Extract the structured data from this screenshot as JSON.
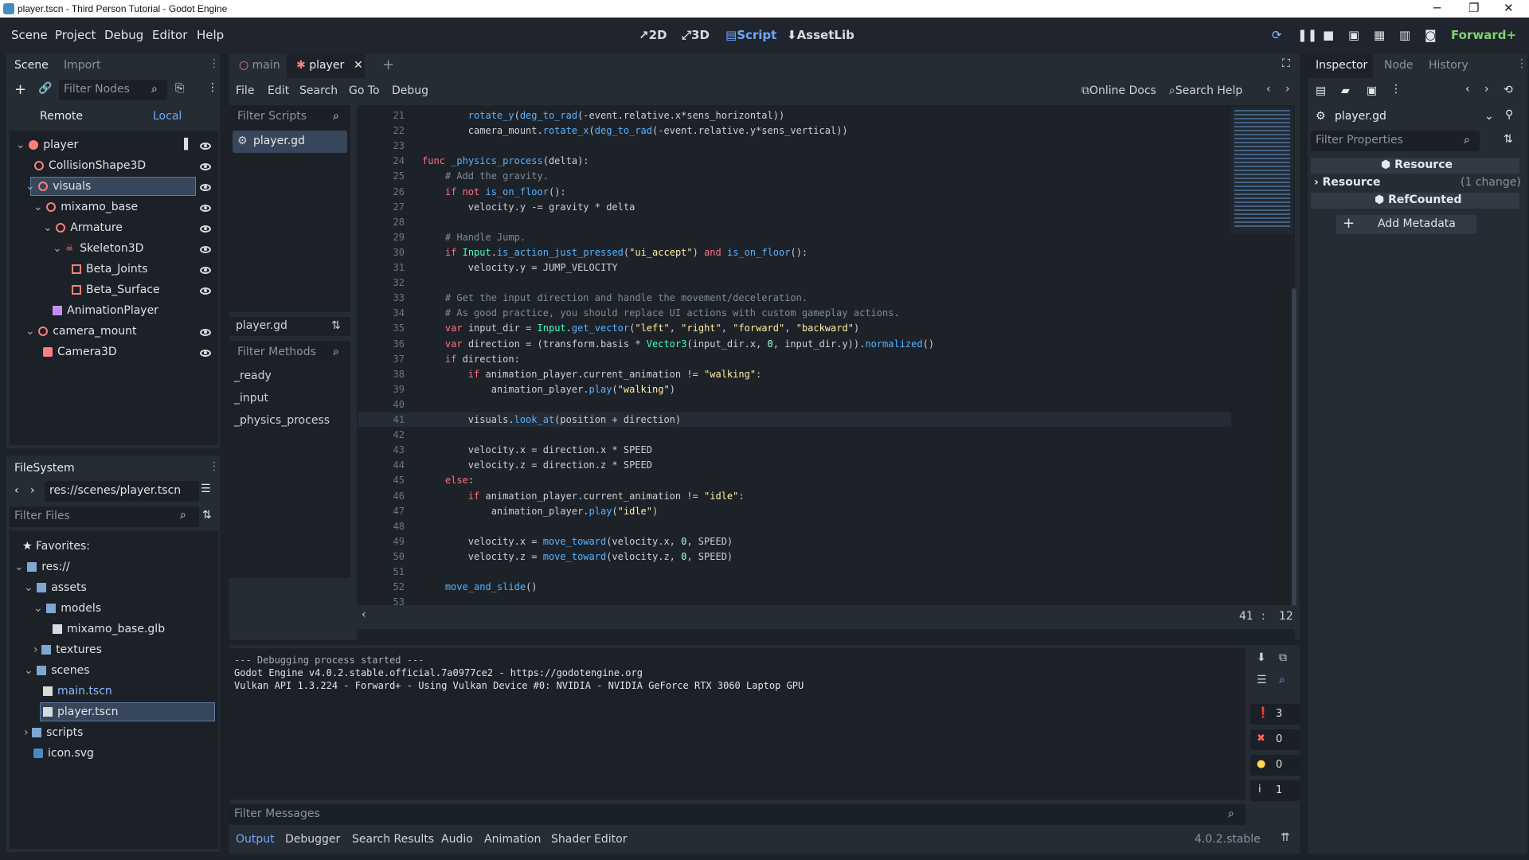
{
  "window_title": "player.tscn - Third Person Tutorial - Godot Engine",
  "menu": [
    "Scene",
    "Project",
    "Debug",
    "Editor",
    "Help"
  ],
  "workspaces": [
    "2D",
    "3D",
    "Script",
    "AssetLib"
  ],
  "renderer": "Forward+",
  "scene_panel": {
    "tabs": [
      "Scene",
      "Import"
    ],
    "filter_placeholder": "Filter Nodes",
    "remote": "Remote",
    "local": "Local",
    "nodes": [
      "player",
      "CollisionShape3D",
      "visuals",
      "mixamo_base",
      "Armature",
      "Skeleton3D",
      "Beta_Joints",
      "Beta_Surface",
      "AnimationPlayer",
      "camera_mount",
      "Camera3D"
    ]
  },
  "filesystem": {
    "tab": "FileSystem",
    "path": "res://scenes/player.tscn",
    "filter_placeholder": "Filter Files",
    "items": [
      "Favorites:",
      "res://",
      "assets",
      "models",
      "mixamo_base.glb",
      "textures",
      "scenes",
      "main.tscn",
      "player.tscn",
      "scripts",
      "icon.svg"
    ]
  },
  "editor_tabs": [
    "main",
    "player"
  ],
  "script_menu": [
    "File",
    "Edit",
    "Search",
    "Go To",
    "Debug"
  ],
  "online_docs": "Online Docs",
  "search_help": "Search Help",
  "scripts_panel": {
    "filter_placeholder": "Filter Scripts",
    "scripts": [
      "player.gd"
    ],
    "current": "player.gd",
    "methods_placeholder": "Filter Methods",
    "methods": [
      "_ready",
      "_input",
      "_physics_process"
    ]
  },
  "cursor_line": "41",
  "cursor_col": "12",
  "code": [
    {
      "n": "21",
      "h": "        <span class='fn'>rotate_y</span>(<span class='fn'>deg_to_rad</span>(-event.relative.x*sens_horizontal))"
    },
    {
      "n": "22",
      "h": "        camera_mount.<span class='fn'>rotate_x</span>(<span class='fn'>deg_to_rad</span>(-event.relative.y*sens_vertical))"
    },
    {
      "n": "23",
      "h": ""
    },
    {
      "n": "24",
      "h": "<span class='kw'>func</span> <span class='fn'>_physics_process</span>(delta):"
    },
    {
      "n": "25",
      "h": "    <span class='cm'># Add the gravity.</span>"
    },
    {
      "n": "26",
      "h": "    <span class='kw'>if not</span> <span class='fn'>is_on_floor</span>():"
    },
    {
      "n": "27",
      "h": "        velocity.y -= gravity * delta"
    },
    {
      "n": "28",
      "h": ""
    },
    {
      "n": "29",
      "h": "    <span class='cm'># Handle Jump.</span>"
    },
    {
      "n": "30",
      "h": "    <span class='kw'>if</span> <span class='ty'>Input</span>.<span class='fn'>is_action_just_pressed</span>(<span class='str'>\"ui_accept\"</span>) <span class='kw'>and</span> <span class='fn'>is_on_floor</span>():"
    },
    {
      "n": "31",
      "h": "        velocity.y = JUMP_VELOCITY"
    },
    {
      "n": "32",
      "h": ""
    },
    {
      "n": "33",
      "h": "    <span class='cm'># Get the input direction and handle the movement/deceleration.</span>"
    },
    {
      "n": "34",
      "h": "    <span class='cm'># As good practice, you should replace UI actions with custom gameplay actions.</span>"
    },
    {
      "n": "35",
      "h": "    <span class='kw'>var</span> input_dir = <span class='ty'>Input</span>.<span class='fn'>get_vector</span>(<span class='str'>\"left\"</span>, <span class='str'>\"right\"</span>, <span class='str'>\"forward\"</span>, <span class='str'>\"backward\"</span>)"
    },
    {
      "n": "36",
      "h": "    <span class='kw'>var</span> direction = (transform.basis * <span class='ty'>Vector3</span>(input_dir.x, <span class='num'>0</span>, input_dir.y)).<span class='fn'>normalized</span>()"
    },
    {
      "n": "37",
      "h": "    <span class='kw'>if</span> direction:"
    },
    {
      "n": "38",
      "h": "        <span class='kw'>if</span> animation_player.current_animation != <span class='str'>\"walking\"</span>:"
    },
    {
      "n": "39",
      "h": "            animation_player.<span class='fn'>play</span>(<span class='str'>\"walking\"</span>)"
    },
    {
      "n": "40",
      "h": ""
    },
    {
      "n": "41",
      "h": "        visuals.<span class='fn'>look_at</span>(position + direction)"
    },
    {
      "n": "42",
      "h": ""
    },
    {
      "n": "43",
      "h": "        velocity.x = direction.x * SPEED"
    },
    {
      "n": "44",
      "h": "        velocity.z = direction.z * SPEED"
    },
    {
      "n": "45",
      "h": "    <span class='kw'>else</span>:"
    },
    {
      "n": "46",
      "h": "        <span class='kw'>if</span> animation_player.current_animation != <span class='str'>\"idle\"</span>:"
    },
    {
      "n": "47",
      "h": "            animation_player.<span class='fn'>play</span>(<span class='str'>\"idle\"</span>)"
    },
    {
      "n": "48",
      "h": ""
    },
    {
      "n": "49",
      "h": "        velocity.x = <span class='fn'>move_toward</span>(velocity.x, <span class='num'>0</span>, SPEED)"
    },
    {
      "n": "50",
      "h": "        velocity.z = <span class='fn'>move_toward</span>(velocity.z, <span class='num'>0</span>, SPEED)"
    },
    {
      "n": "51",
      "h": ""
    },
    {
      "n": "52",
      "h": "    <span class='fn'>move_and_slide</span>()"
    },
    {
      "n": "53",
      "h": ""
    }
  ],
  "output": {
    "lines": [
      "--- Debugging process started ---",
      "Godot Engine v4.0.2.stable.official.7a0977ce2 - https://godotengine.org",
      "Vulkan API 1.3.224 - Forward+ - Using Vulkan Device #0: NVIDIA - NVIDIA GeForce RTX 3060 Laptop GPU"
    ],
    "filter_placeholder": "Filter Messages",
    "counts": [
      "3",
      "0",
      "0",
      "1"
    ]
  },
  "bottom_tabs": [
    "Output",
    "Debugger",
    "Search Results",
    "Audio",
    "Animation",
    "Shader Editor"
  ],
  "version": "4.0.2.stable",
  "inspector": {
    "tabs": [
      "Inspector",
      "Node",
      "History"
    ],
    "resource_name": "player.gd",
    "filter_placeholder": "Filter Properties",
    "section_resource": "Resource",
    "resource_label": "Resource",
    "resource_change": "(1 change)",
    "section_refcounted": "RefCounted",
    "add_metadata": "Add Metadata"
  }
}
